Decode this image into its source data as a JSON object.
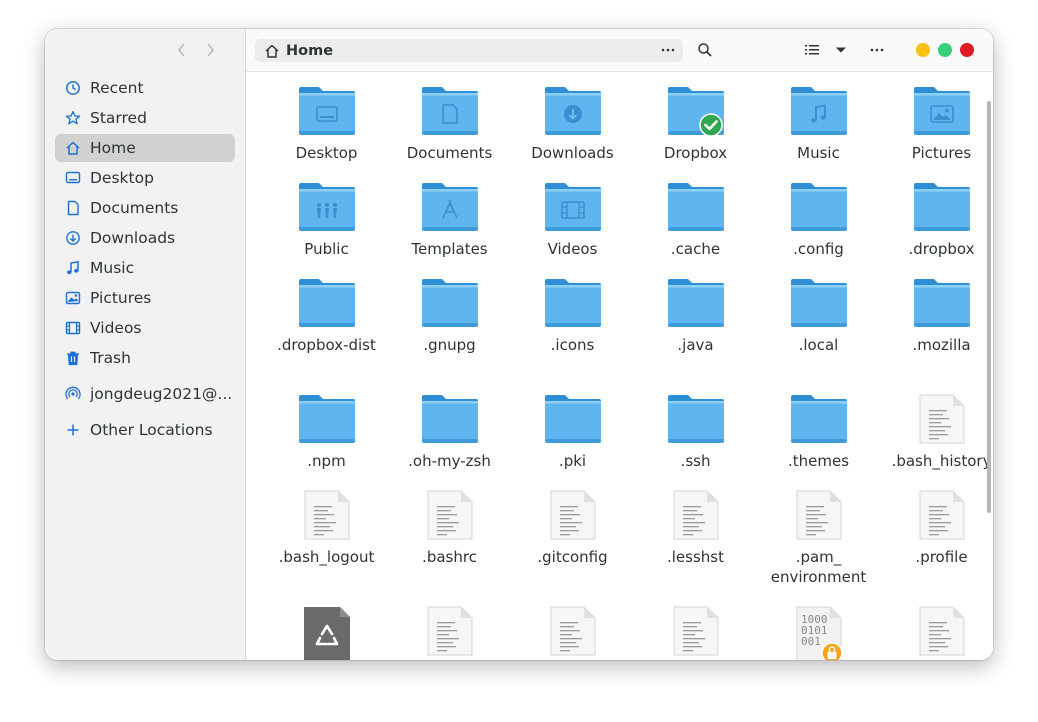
{
  "header": {
    "path": "Home"
  },
  "sidebar": {
    "items": [
      {
        "label": "Recent",
        "icon": "clock-icon"
      },
      {
        "label": "Starred",
        "icon": "star-icon"
      },
      {
        "label": "Home",
        "icon": "home-icon",
        "active": true
      },
      {
        "label": "Desktop",
        "icon": "desktop-icon"
      },
      {
        "label": "Documents",
        "icon": "document-icon"
      },
      {
        "label": "Downloads",
        "icon": "download-icon"
      },
      {
        "label": "Music",
        "icon": "music-icon"
      },
      {
        "label": "Pictures",
        "icon": "picture-icon"
      },
      {
        "label": "Videos",
        "icon": "film-icon"
      },
      {
        "label": "Trash",
        "icon": "trash-icon"
      }
    ],
    "network": {
      "label": "jongdeug2021@...",
      "icon": "network-icon"
    },
    "other": {
      "label": "Other Locations",
      "icon": "plus-icon"
    }
  },
  "colors": {
    "accent": "#3584e4",
    "folder": "#5fb6ee",
    "minimize": "#f5c211",
    "maximize": "#33d17a",
    "close": "#e01b24"
  },
  "files": [
    {
      "name": "Desktop",
      "kind": "folder",
      "emblem": "desktop"
    },
    {
      "name": "Documents",
      "kind": "folder",
      "emblem": "document"
    },
    {
      "name": "Downloads",
      "kind": "folder",
      "emblem": "download"
    },
    {
      "name": "Dropbox",
      "kind": "folder",
      "emblem": "check"
    },
    {
      "name": "Music",
      "kind": "folder",
      "emblem": "music"
    },
    {
      "name": "Pictures",
      "kind": "folder",
      "emblem": "picture"
    },
    {
      "name": "Public",
      "kind": "folder",
      "emblem": "people"
    },
    {
      "name": "Templates",
      "kind": "folder",
      "emblem": "template"
    },
    {
      "name": "Videos",
      "kind": "folder",
      "emblem": "film"
    },
    {
      "name": ".cache",
      "kind": "folder"
    },
    {
      "name": ".config",
      "kind": "folder"
    },
    {
      "name": ".dropbox",
      "kind": "folder"
    },
    {
      "name": ".dropbox-dist",
      "kind": "folder"
    },
    {
      "name": ".gnupg",
      "kind": "folder"
    },
    {
      "name": ".icons",
      "kind": "folder"
    },
    {
      "name": ".java",
      "kind": "folder"
    },
    {
      "name": ".local",
      "kind": "folder"
    },
    {
      "name": ".mozilla",
      "kind": "folder"
    },
    {
      "name": ".npm",
      "kind": "folder"
    },
    {
      "name": ".oh-my-zsh",
      "kind": "folder"
    },
    {
      "name": ".pki",
      "kind": "folder"
    },
    {
      "name": ".ssh",
      "kind": "folder"
    },
    {
      "name": ".themes",
      "kind": "folder"
    },
    {
      "name": ".bash_history",
      "kind": "text"
    },
    {
      "name": ".bash_logout",
      "kind": "text"
    },
    {
      "name": ".bashrc",
      "kind": "text"
    },
    {
      "name": ".gitconfig",
      "kind": "text"
    },
    {
      "name": ".lesshst",
      "kind": "text"
    },
    {
      "name": ".pam_ environment",
      "kind": "text"
    },
    {
      "name": ".profile",
      "kind": "text"
    },
    {
      "name": "",
      "kind": "recycle"
    },
    {
      "name": "",
      "kind": "text"
    },
    {
      "name": "",
      "kind": "text"
    },
    {
      "name": "",
      "kind": "text"
    },
    {
      "name": "",
      "kind": "binary",
      "binary_text": [
        "1000",
        "0101",
        "001"
      ]
    },
    {
      "name": "",
      "kind": "text"
    }
  ]
}
